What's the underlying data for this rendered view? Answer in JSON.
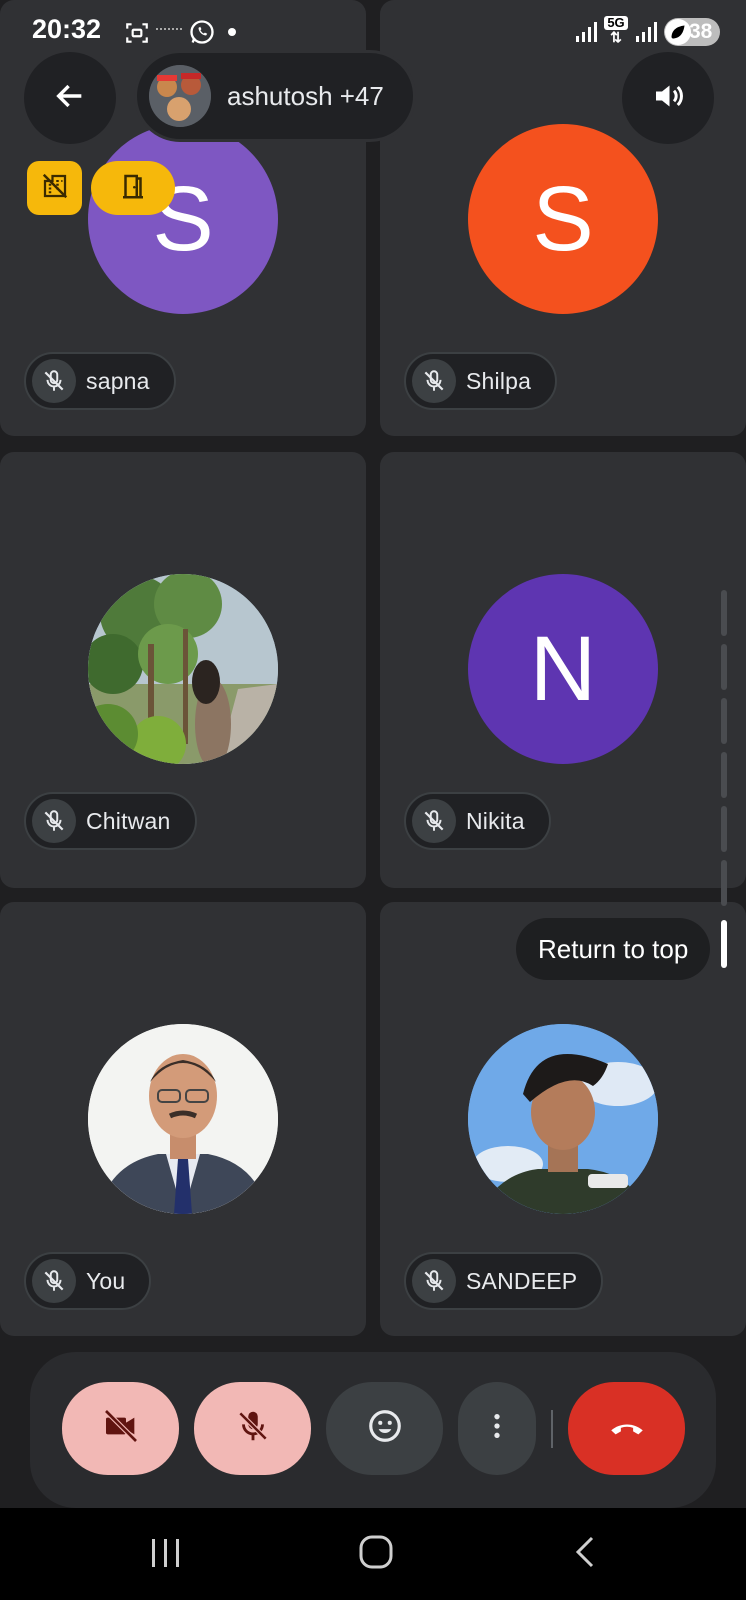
{
  "status_bar": {
    "time": "20:32",
    "battery": "38",
    "network": "5G"
  },
  "top_bar": {
    "back_icon": "arrow-left-icon",
    "group_label": "ashutosh +47",
    "speaker_icon": "speaker-icon"
  },
  "badges": {
    "left_icon": "no-building-icon",
    "right_icon": "door-icon"
  },
  "participants": [
    {
      "name": "sapna",
      "initial": "S",
      "color": "#7e57c2",
      "muted": true
    },
    {
      "name": "Shilpa",
      "initial": "S",
      "color": "#f4511e",
      "muted": true
    },
    {
      "name": "Chitwan",
      "initial": "",
      "photo": "outdoor-trees-photo",
      "muted": true
    },
    {
      "name": "Nikita",
      "initial": "N",
      "color": "#5e35b1",
      "muted": true
    },
    {
      "name": "You",
      "initial": "",
      "photo": "man-in-suit-photo",
      "muted": true
    },
    {
      "name": "SANDEEP",
      "initial": "",
      "photo": "young-man-selfie-photo",
      "muted": true
    }
  ],
  "return_to_top": "Return to top",
  "controls": {
    "camera_icon": "camera-off-icon",
    "mic_icon": "mic-off-icon",
    "emoji_icon": "smiley-icon",
    "more_icon": "more-vert-icon",
    "hangup_icon": "phone-hangup-icon",
    "muted_bg": "#f2b8b5",
    "hangup_bg": "#d93025"
  },
  "nav": {
    "recent_icon": "recent-apps-icon",
    "home_icon": "home-icon",
    "back_icon": "nav-back-icon"
  }
}
